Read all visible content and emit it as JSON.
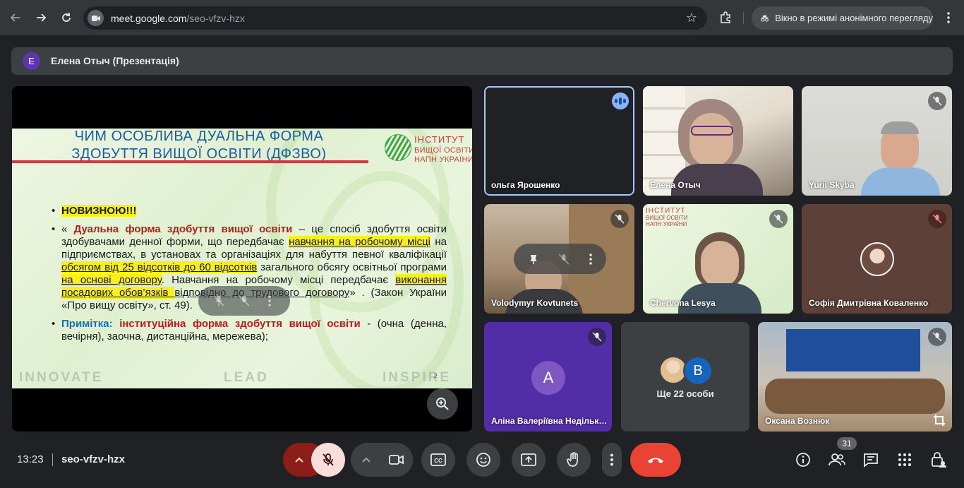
{
  "browser": {
    "url_host": "meet.google.com",
    "url_path": "/seo-vfzv-hzx",
    "incognito_label": "Вікно в режимі анонімного перегляду"
  },
  "presentation": {
    "avatar_letter": "E",
    "title": "Елена Отыч (Презентація)"
  },
  "slide": {
    "title_line1": "ЧИМ ОСОБЛИВА  ДУАЛЬНА  ФОРМА",
    "title_line2": "ЗДОБУТТЯ ВИЩОЇ ОСВІТИ   (ДФЗВО)",
    "logo_line1": "ІНСТИТУТ",
    "logo_line2": "ВИЩОЇ ОСВІТИ",
    "logo_line3": "НАПН УКРАЇНИ",
    "bullet1": "НОВИЗНОЮ!!!",
    "b2_open": "« ",
    "b2_term": "Дуальна форма здобуття вищої освіти",
    "b2_t1": " –    це спосіб здобуття освіти здобувачами денної форми, що передбачає ",
    "b2_h1": "навчання на робочому місці",
    "b2_t2": " на підприємствах, в установах та організаціях для набуття певної кваліфікації ",
    "b2_h2": "обсягом від 25 відсотків до 60 відсотків",
    "b2_t3": " загального обсягу освітньої програми ",
    "b2_h3": "на основі договору",
    "b2_t4": ". Навчання на робочому місці передбачає ",
    "b2_h4": "виконання посадових обов’язків ",
    "b2_t5": "відповідно до трудового договору",
    "b2_t6": "» . (Закон України «Про вищу освіту», ст. 49).",
    "b3_lead": "Примітка: ",
    "b3_term": "інституційна  форма здобуття вищої освіти",
    "b3_rest": " -  (очна (денна, вечірня), заочна, дистанційна, мережева);",
    "footer_1": "INNOVATE",
    "footer_2": "LEAD",
    "footer_3": "INSPIRE",
    "page_number": "2"
  },
  "participants": [
    {
      "name": "ольга Ярошенко"
    },
    {
      "name": "Елена Отыч"
    },
    {
      "name": "Yurii Skyba"
    },
    {
      "name": "Volodymyr Kovtunets"
    },
    {
      "name": "Chervona Lesya"
    },
    {
      "name": "Софія Дмитрівна Коваленко"
    },
    {
      "name": "Аліна Валеріївна Недільк…",
      "avatar_letter": "A"
    },
    {
      "name": "Ще 22 особи",
      "avatar_letter": "B"
    },
    {
      "name": "Оксана Вознюк"
    }
  ],
  "tile_logo": {
    "line1": "ІНСТИТУТ",
    "line2": "ВИЩОЇ ОСВІТИ",
    "line3": "НАПН УКРАЇНИ"
  },
  "bottom_bar": {
    "time": "13:23",
    "meeting_code": "seo-vfzv-hzx",
    "people_count": "31"
  },
  "colors": {
    "end_call": "#ea4335",
    "mic_off": "#f9dedc",
    "speaking_outline": "#a8c7fa"
  }
}
